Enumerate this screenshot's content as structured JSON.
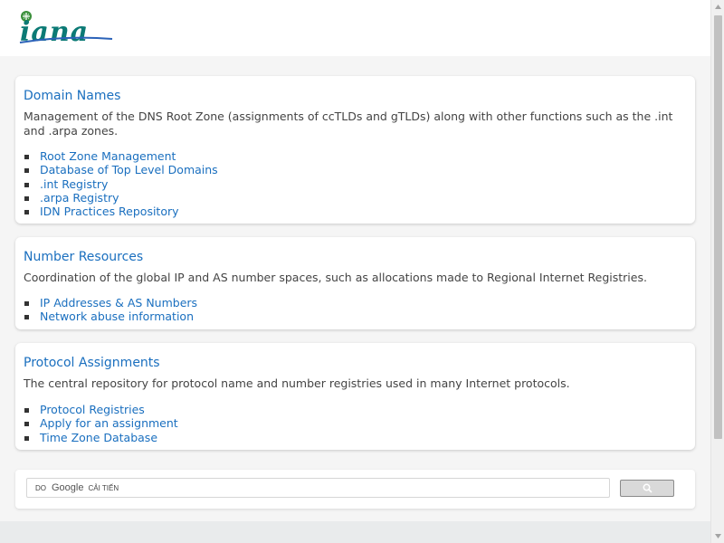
{
  "header": {
    "logo_text": "iana",
    "logo_color": "#0b7a75"
  },
  "sections": [
    {
      "title": "Domain Names",
      "description": "Management of the DNS Root Zone (assignments of ccTLDs and gTLDs) along with other functions such as the .int and .arpa zones.",
      "links": [
        "Root Zone Management",
        "Database of Top Level Domains",
        ".int Registry",
        ".arpa Registry",
        "IDN Practices Repository"
      ]
    },
    {
      "title": "Number Resources",
      "description": "Coordination of the global IP and AS number spaces, such as allocations made to Regional Internet Registries.",
      "links": [
        "IP Addresses & AS Numbers",
        "Network abuse information"
      ]
    },
    {
      "title": "Protocol Assignments",
      "description": "The central repository for protocol name and number registries used in many Internet protocols.",
      "links": [
        "Protocol Registries",
        "Apply for an assignment",
        "Time Zone Database"
      ]
    }
  ],
  "search": {
    "prefix": "DO",
    "brand": "Google",
    "suffix": "CẢI TIẾN",
    "button_icon": "search-icon"
  },
  "colors": {
    "link": "#1a6fbf",
    "page_bg": "#f5f5f5",
    "card_bg": "#ffffff"
  }
}
